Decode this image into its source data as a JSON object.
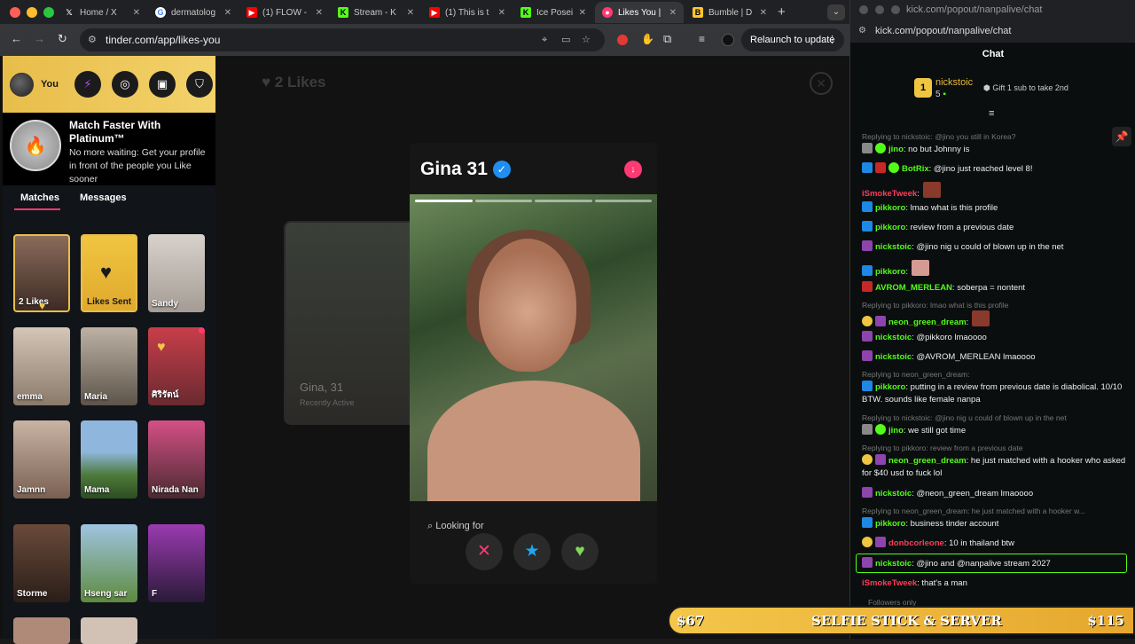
{
  "browser": {
    "tabs": [
      {
        "label": "Home / X",
        "icon": "x-icon"
      },
      {
        "label": "dermatolog",
        "icon": "google-icon"
      },
      {
        "label": "(1) FLOW -",
        "icon": "youtube-icon"
      },
      {
        "label": "Stream - K",
        "icon": "kick-icon"
      },
      {
        "label": "(1) This is t",
        "icon": "youtube-icon"
      },
      {
        "label": "Ice Posei",
        "icon": "kick-icon"
      },
      {
        "label": "Likes You |",
        "icon": "tinder-icon"
      },
      {
        "label": "Bumble | D",
        "icon": "bumble-icon"
      }
    ],
    "url": "tinder.com/app/likes-you",
    "relaunch_label": "Relaunch to update"
  },
  "tinder": {
    "profile_label": "You",
    "promo": {
      "title": "Match Faster With Platinum™",
      "text": "No more waiting: Get your profile in front of the people you Like sooner"
    },
    "tabs": {
      "matches": "Matches",
      "messages": "Messages"
    },
    "grid": [
      {
        "label": "2 Likes"
      },
      {
        "label": "Likes Sent"
      },
      {
        "label": "Sandy"
      },
      {
        "label": "emma"
      },
      {
        "label": "Maria"
      },
      {
        "label": "ศิริรัตน์"
      },
      {
        "label": "Jamnn"
      },
      {
        "label": "Mama"
      },
      {
        "label": "Nirada Nan"
      },
      {
        "label": "Storme"
      },
      {
        "label": "Hseng sar"
      },
      {
        "label": "F"
      }
    ],
    "likes_header": "2 Likes",
    "bg_card": {
      "name": "Gina, 31",
      "status": "Recently Active"
    },
    "profile": {
      "name": "Gina",
      "age": "31",
      "looking_for": "Looking for"
    }
  },
  "chat": {
    "window_url_title": "kick.com/popout/nanpalive/chat",
    "url": "kick.com/popout/nanpalive/chat",
    "header": "Chat",
    "pinned": {
      "rank": "1",
      "name": "nickstoic",
      "count": "5",
      "gift_text": "Gift 1 sub to take 2nd"
    },
    "messages": [
      {
        "type": "reply",
        "text": "Replying to nickstoic: @jino you still in Korea?"
      },
      {
        "user": "jino",
        "color": "#53fc18",
        "text": ": no but Johnny is"
      },
      {
        "user": "BotRix",
        "color": "#53fc18",
        "text": ": @jino just reached level 8!"
      },
      {
        "user": "iSmokeTweek",
        "color": "#ff3b5b",
        "text": ":"
      },
      {
        "user": "pikkoro",
        "color": "#53fc18",
        "text": ": lmao what is this profile"
      },
      {
        "user": "pikkoro",
        "color": "#53fc18",
        "text": ": review from a previous date"
      },
      {
        "user": "nickstoic",
        "color": "#53fc18",
        "text": ": @jino nig u could of blown up in the net"
      },
      {
        "user": "pikkoro",
        "color": "#53fc18",
        "text": ":"
      },
      {
        "user": "AVROM_MERLEAN",
        "color": "#53fc18",
        "text": ": soberpa = nontent"
      },
      {
        "type": "reply",
        "text": "Replying to pikkoro: lmao what is this profile"
      },
      {
        "user": "neon_green_dream",
        "color": "#53fc18",
        "text": ":"
      },
      {
        "user": "nickstoic",
        "color": "#53fc18",
        "text": ": @pikkoro lmaoooo"
      },
      {
        "user": "nickstoic",
        "color": "#53fc18",
        "text": ": @AVROM_MERLEAN lmaoooo"
      },
      {
        "type": "reply",
        "text": "Replying to neon_green_dream:"
      },
      {
        "user": "pikkoro",
        "color": "#53fc18",
        "text": ": putting in a review from previous date is diabolical. 10/10 BTW. sounds like female nanpa"
      },
      {
        "type": "reply",
        "text": "Replying to nickstoic: @jino nig u could of blown up in the net"
      },
      {
        "user": "jino",
        "color": "#53fc18",
        "text": ": we still got time"
      },
      {
        "type": "reply",
        "text": "Replying to pikkoro: review from a previous date"
      },
      {
        "user": "neon_green_dream",
        "color": "#53fc18",
        "text": ": he just matched with a hooker who asked for $40 usd to fuck lol"
      },
      {
        "user": "nickstoic",
        "color": "#53fc18",
        "text": ": @neon_green_dream lmaoooo"
      },
      {
        "type": "reply",
        "text": "Replying to neon_green_dream: he just matched with a hooker w..."
      },
      {
        "user": "pikkoro",
        "color": "#53fc18",
        "text": ": business tinder account"
      },
      {
        "user": "donbcorleone",
        "color": "#ff3b5b",
        "text": ": 10 in thailand btw"
      },
      {
        "user": "nickstoic",
        "color": "#53fc18",
        "text": ": @jino and @nanpalive stream 2027"
      },
      {
        "user": "iSmokeTweek",
        "color": "#ff3b5b",
        "text": ": that's a man"
      }
    ],
    "followers_only": "Followers only"
  },
  "banner": {
    "left": "$67",
    "center": "SELFIE STICK & SERVER",
    "right": "$115"
  }
}
